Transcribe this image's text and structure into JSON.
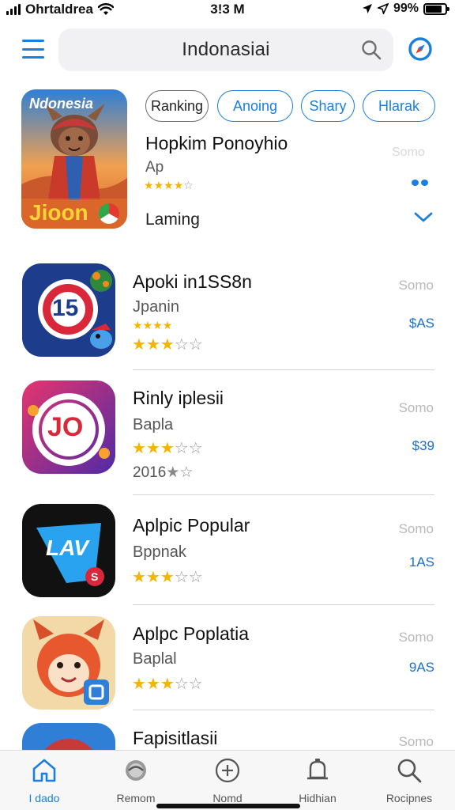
{
  "status_bar": {
    "carrier": "Ohrtaldrea",
    "time": "3!3 M",
    "battery": "99%"
  },
  "header": {
    "title": "Indonasiai",
    "menu_icon": "hamburger-menu-icon",
    "search_icon": "search-icon",
    "compass_icon": "compass-icon"
  },
  "featured": {
    "icon_text_top": "Ndonesia",
    "icon_text_bottom": "Jioon",
    "chips": [
      "Ranking",
      "Anoing",
      "Shary",
      "Hlarak"
    ],
    "title": "Hopkim Ponoyhio",
    "subtitle": "Ap",
    "get_label": "Somo",
    "category": "Laming",
    "rating": 4,
    "accent": "#1a7fe0"
  },
  "apps": [
    {
      "name": "Apoki in1SS8n",
      "developer": "Jpanin",
      "get_label": "Somo",
      "price": "$AS",
      "rating": 3,
      "small_rating": 4,
      "icon_text": "15"
    },
    {
      "name": "Rinly iplesii",
      "developer": "Bapla",
      "get_label": "Somo",
      "price": "$39",
      "rating": 3,
      "year": "2016",
      "icon_text": "JO"
    },
    {
      "name": "Aplpic Popular",
      "developer": "Bppnak",
      "get_label": "Somo",
      "price": "1AS",
      "rating": 3,
      "icon_text": "LAV",
      "badge_text": "S"
    },
    {
      "name": "Aplpc Poplatia",
      "developer": "Baplal",
      "get_label": "Somo",
      "price": "9AS",
      "rating": 3
    },
    {
      "name": "Fapisitlasii",
      "get_label": "Somo"
    }
  ],
  "tabs": [
    {
      "label": "I dado",
      "icon": "home-icon",
      "active": true
    },
    {
      "label": "Remom",
      "icon": "globe-icon",
      "active": false
    },
    {
      "label": "Nomd",
      "icon": "add-circle-icon",
      "active": false
    },
    {
      "label": "Hidhian",
      "icon": "bell-icon",
      "active": false
    },
    {
      "label": "Rocipnes",
      "icon": "search-icon",
      "active": false
    }
  ]
}
